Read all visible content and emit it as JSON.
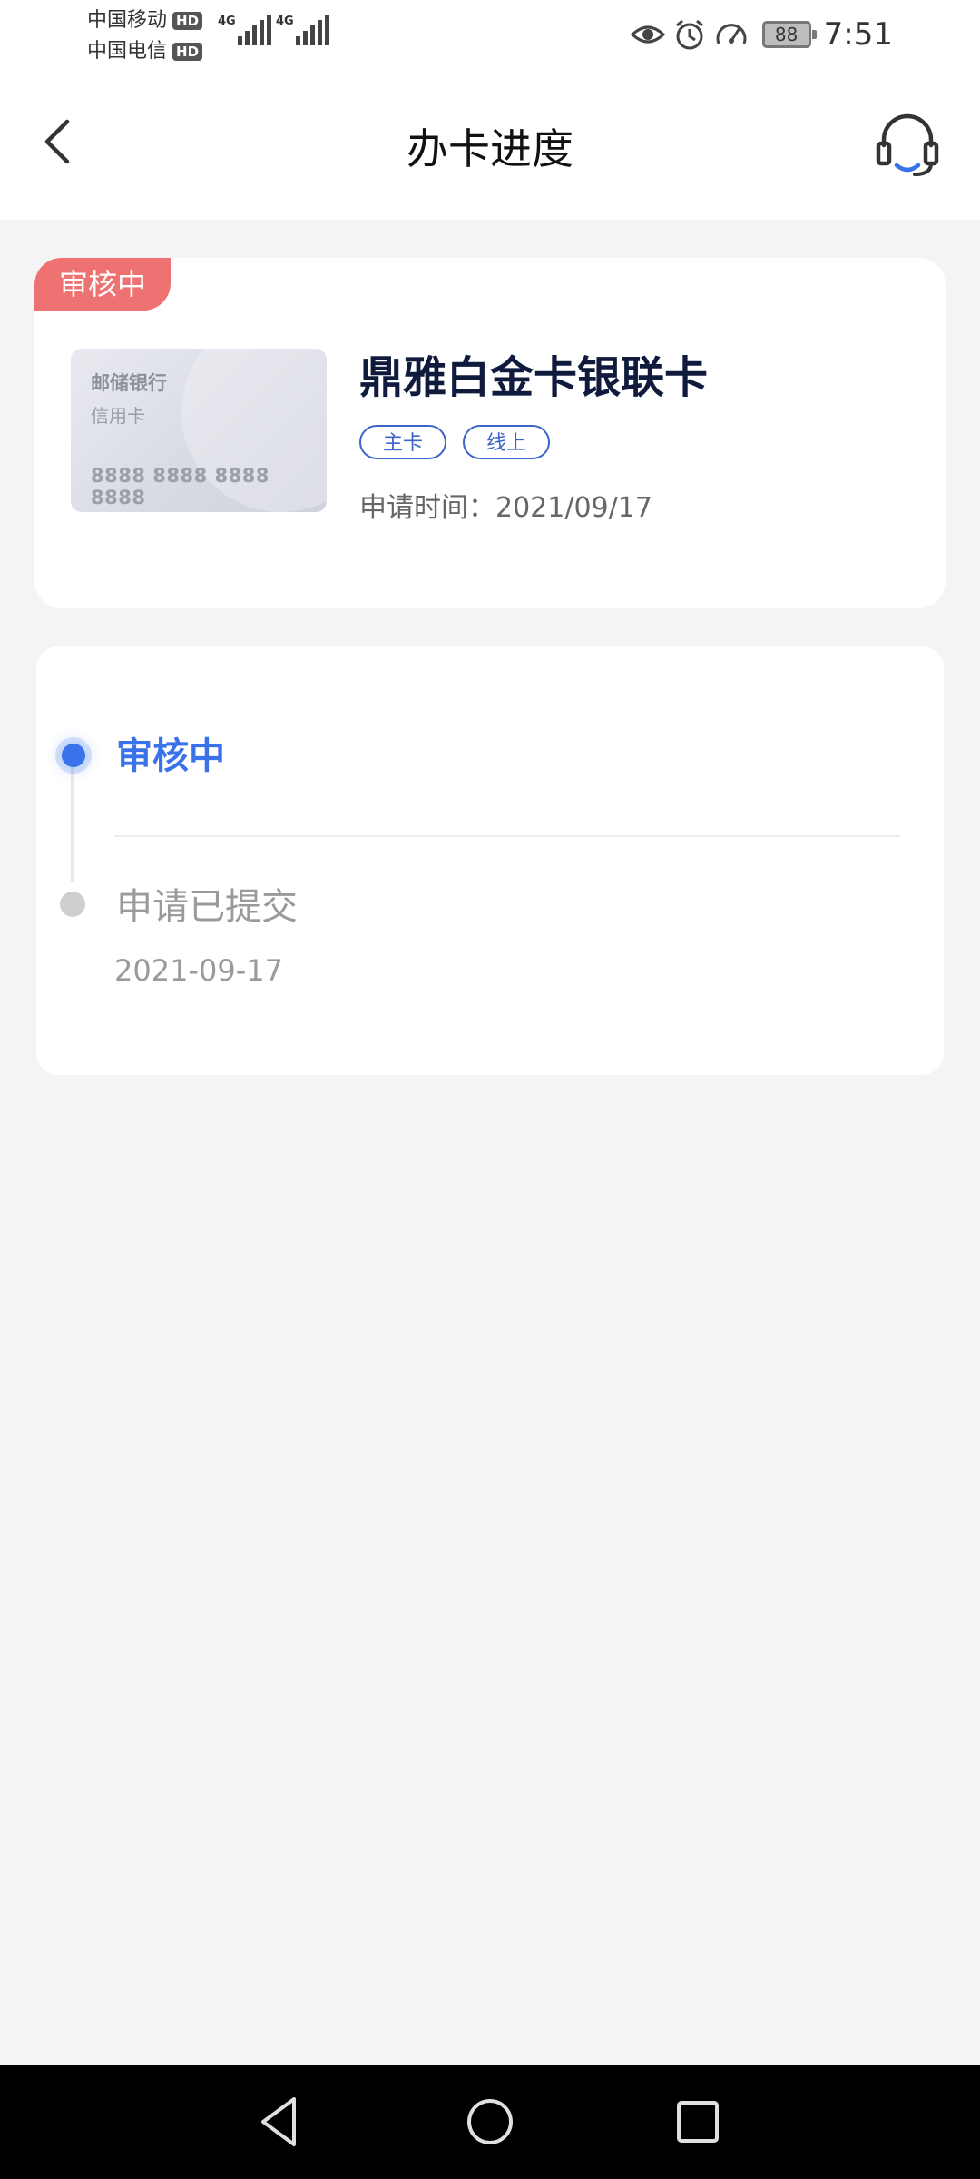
{
  "status_bar": {
    "carriers": [
      {
        "name": "中国移动",
        "badge": "HD",
        "network": "4G"
      },
      {
        "name": "中国电信",
        "badge": "HD",
        "network": "4G"
      }
    ],
    "battery": "88",
    "time": "7:51",
    "icons": [
      "eye-icon",
      "alarm-icon",
      "speedometer-icon",
      "battery-icon"
    ]
  },
  "header": {
    "title": "办卡进度",
    "back_icon": "chevron-left-icon",
    "service_icon": "headset-icon"
  },
  "card": {
    "status_tag": "审核中",
    "image": {
      "bank": "邮储银行",
      "type": "信用卡",
      "number": "8888 8888 8888 8888"
    },
    "name": "鼎雅白金卡银联卡",
    "tags": [
      "主卡",
      "线上"
    ],
    "apply_time": "申请时间：2021/09/17"
  },
  "progress": {
    "steps": [
      {
        "label": "审核中",
        "state": "current"
      },
      {
        "label": "申请已提交",
        "date": "2021-09-17",
        "state": "done"
      }
    ]
  },
  "colors": {
    "accent": "#3a72ea",
    "tag_red": "#ef7272",
    "pill_blue": "#3c64c7"
  },
  "nav": {
    "buttons": [
      "back-triangle-icon",
      "home-circle-icon",
      "recents-square-icon"
    ]
  }
}
